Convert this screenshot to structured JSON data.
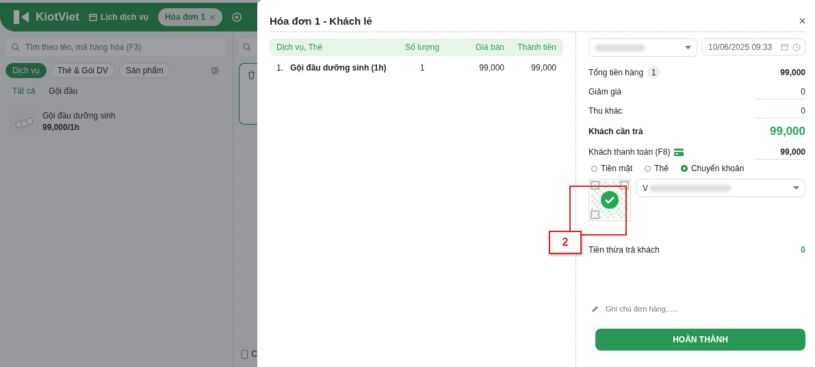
{
  "app": {
    "logo": "KiotViet",
    "nav": [
      {
        "label": "Lịch dịch vụ",
        "kind": "link"
      },
      {
        "label": "Hóa đơn 1",
        "kind": "tab",
        "selected": true
      }
    ],
    "search": {
      "placeholder": "Tìm theo tên, mã hàng hóa (F3)"
    },
    "categories": [
      {
        "label": "Dịch vụ",
        "selected": true
      },
      {
        "label": "Thẻ & Gói DV",
        "selected": false
      },
      {
        "label": "Sản phẩm",
        "selected": false
      }
    ],
    "groups": [
      {
        "label": "Tất cả",
        "selected": true
      },
      {
        "label": "Gội đầu",
        "selected": false
      }
    ],
    "products": [
      {
        "name": "Gội đầu dưỡng sinh",
        "price": "99,000/1h"
      }
    ],
    "footer_checkbox": {
      "label": "C",
      "checked": false
    }
  },
  "dialog": {
    "title": "Hóa đơn 1 - Khách lẻ",
    "columns": [
      "Dịch vụ, Thẻ",
      "Số lượng",
      "Giá bán",
      "Thành tiền"
    ],
    "rows": [
      {
        "index": "1.",
        "name": "Gội đầu dưỡng sinh (1h)",
        "qty": "1",
        "price": "99,000",
        "total": "99,000"
      }
    ],
    "datetime": "10/06/2025 09:33",
    "summary": [
      {
        "kind": "count",
        "label": "Tổng tiền hàng",
        "badge": "1",
        "value": "99,000"
      },
      {
        "kind": "input",
        "label": "Giảm giá",
        "value": "0"
      },
      {
        "kind": "input",
        "label": "Thu khác",
        "value": "0"
      },
      {
        "kind": "total",
        "label": "Khách cần trả",
        "value": "99,000"
      },
      {
        "kind": "payment",
        "label": "Khách thanh toán (F8)",
        "value": "99,000"
      }
    ],
    "methods": [
      {
        "label": "Tiền mặt",
        "selected": false
      },
      {
        "label": "Thẻ",
        "selected": false
      },
      {
        "label": "Chuyển khoản",
        "selected": true
      }
    ],
    "bank_account": "V",
    "change": {
      "label": "Tiền thừa trả khách",
      "value": "0"
    },
    "note": {
      "placeholder": "Ghi chú đơn hàng......"
    },
    "submit": "HOÀN THÀNH"
  },
  "callout": {
    "label": "2"
  }
}
